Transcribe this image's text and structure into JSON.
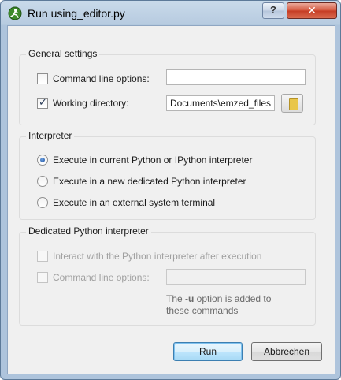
{
  "window": {
    "title": "Run using_editor.py",
    "help_label": "?",
    "close_label": "✕"
  },
  "general": {
    "title": "General settings",
    "cmd_label": "Command line options:",
    "cmd_value": "",
    "workdir_label": "Working directory:",
    "workdir_value": "Documents\\emzed_files"
  },
  "interpreter": {
    "title": "Interpreter",
    "options": [
      "Execute in current Python or IPython interpreter",
      "Execute in a new dedicated Python interpreter",
      "Execute in an external system terminal"
    ]
  },
  "dedicated": {
    "title": "Dedicated Python interpreter",
    "interact_label": "Interact with the Python interpreter after execution",
    "cmd_label": "Command line options:",
    "cmd_value": "",
    "note_pre": "The ",
    "note_flag": "-u",
    "note_post": " option is added to",
    "note_line2": "these commands"
  },
  "buttons": {
    "run": "Run",
    "cancel": "Abbrechen"
  }
}
